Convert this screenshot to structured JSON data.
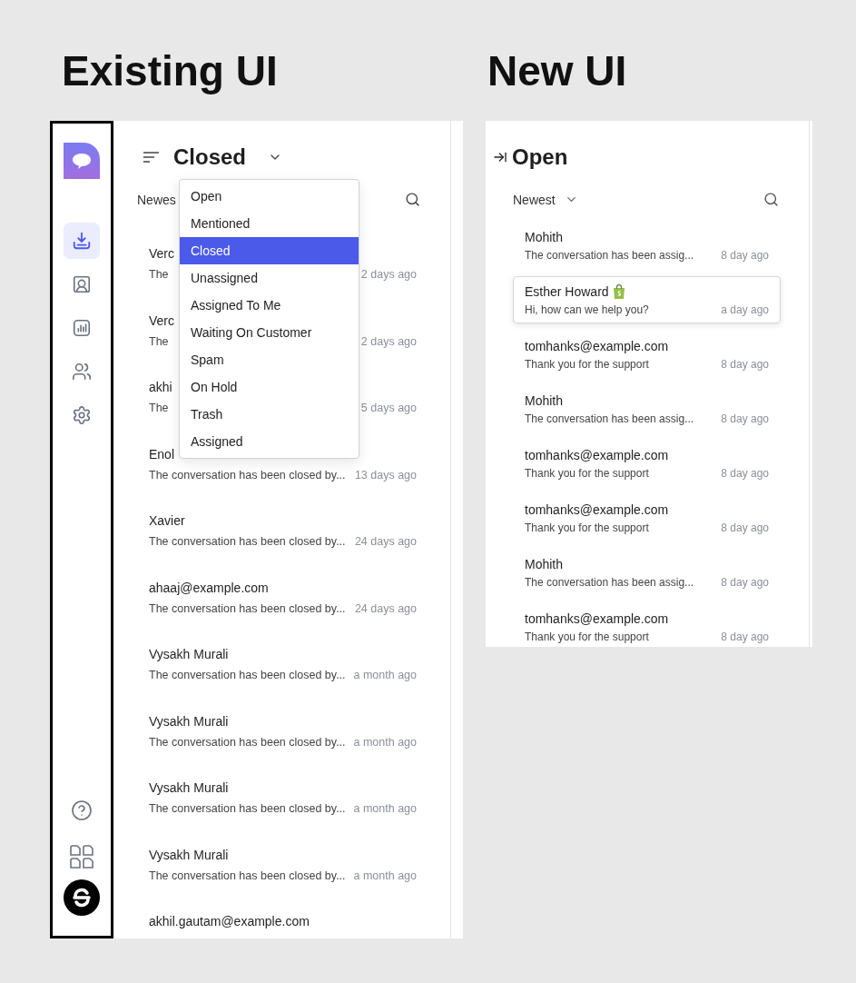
{
  "existing_ui": {
    "heading": "Existing UI",
    "sidebar": {
      "nav_items": [
        {
          "selected": true
        },
        {
          "selected": false
        },
        {
          "selected": false
        },
        {
          "selected": false
        },
        {
          "selected": false
        }
      ]
    },
    "title": "Closed",
    "sort": "Newes",
    "dropdown": [
      {
        "label": "Open",
        "selected": false
      },
      {
        "label": "Mentioned",
        "selected": false
      },
      {
        "label": "Closed",
        "selected": true
      },
      {
        "label": "Unassigned",
        "selected": false
      },
      {
        "label": "Assigned To Me",
        "selected": false
      },
      {
        "label": "Waiting On Customer",
        "selected": false
      },
      {
        "label": "Spam",
        "selected": false
      },
      {
        "label": "On Hold",
        "selected": false
      },
      {
        "label": "Trash",
        "selected": false
      },
      {
        "label": "Assigned",
        "selected": false
      }
    ],
    "conversations": [
      {
        "name": "Verc",
        "preview": "The",
        "time": "2 days ago"
      },
      {
        "name": "Verc",
        "preview": "The",
        "time": "2 days ago"
      },
      {
        "name": "akhi",
        "preview": "The",
        "time": "5 days ago"
      },
      {
        "name": "Enol",
        "preview": "The conversation has been closed by...",
        "time": "13 days ago"
      },
      {
        "name": "Xavier",
        "preview": "The conversation has been closed by...",
        "time": "24 days ago"
      },
      {
        "name": "ahaaj@example.com",
        "preview": "The conversation has been closed by...",
        "time": "24 days ago"
      },
      {
        "name": "Vysakh Murali",
        "preview": "The conversation has been closed by...",
        "time": "a month ago"
      },
      {
        "name": "Vysakh Murali",
        "preview": "The conversation has been closed by...",
        "time": "a month ago"
      },
      {
        "name": "Vysakh Murali",
        "preview": "The conversation has been closed by...",
        "time": "a month ago"
      },
      {
        "name": "Vysakh Murali",
        "preview": "The conversation has been closed by...",
        "time": "a month ago"
      },
      {
        "name": "akhil.gautam@example.com"
      }
    ]
  },
  "new_ui": {
    "heading": "New UI",
    "title": "Open",
    "sort": "Newest",
    "conversations": [
      {
        "name": "Mohith",
        "preview": "The conversation has been assig...",
        "time": "8 day ago",
        "selected": false,
        "store_icon": false
      },
      {
        "name": "Esther Howard",
        "preview": "Hi, how can we help you?",
        "time": "a day ago",
        "selected": true,
        "store_icon": true
      },
      {
        "name": "tomhanks@example.com",
        "preview": "Thank you for the support",
        "time": "8 day ago",
        "selected": false,
        "store_icon": false
      },
      {
        "name": "Mohith",
        "preview": "The conversation has been assig...",
        "time": "8 day ago",
        "selected": false,
        "store_icon": false
      },
      {
        "name": "tomhanks@example.com",
        "preview": "Thank you for the support",
        "time": "8 day ago",
        "selected": false,
        "store_icon": false
      },
      {
        "name": "tomhanks@example.com",
        "preview": "Thank you for the support",
        "time": "8 day ago",
        "selected": false,
        "store_icon": false
      },
      {
        "name": "Mohith",
        "preview": "The conversation has been assig...",
        "time": "8 day ago",
        "selected": false,
        "store_icon": false
      },
      {
        "name": "tomhanks@example.com",
        "preview": "Thank you for the support",
        "time": "8 day ago",
        "selected": false,
        "store_icon": false
      }
    ]
  }
}
